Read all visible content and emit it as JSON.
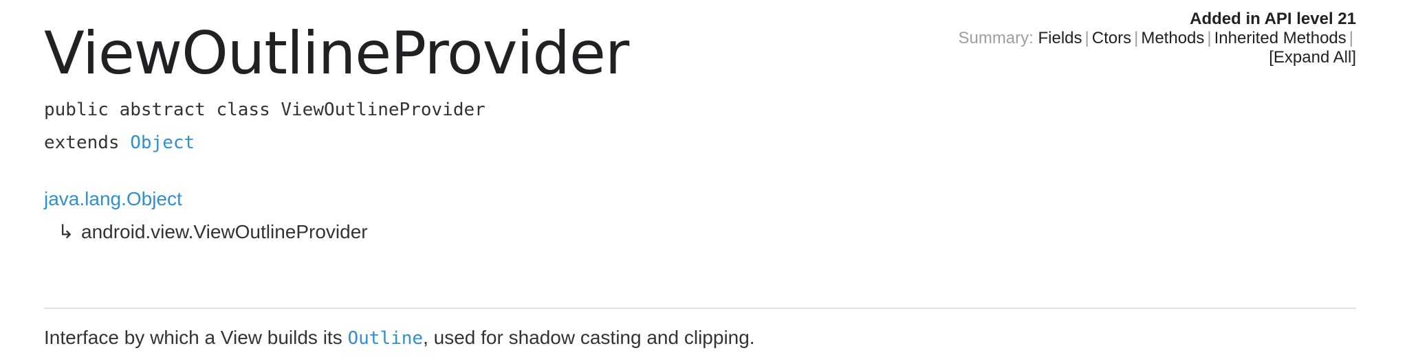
{
  "header": {
    "api_level": "Added in API level 21",
    "summary_label": "Summary:",
    "summary_links": [
      "Fields",
      "Ctors",
      "Methods",
      "Inherited Methods",
      "[Expand All]"
    ],
    "separator": "|"
  },
  "class": {
    "title": "ViewOutlineProvider",
    "declaration": "public abstract class ViewOutlineProvider",
    "extends_keyword": "extends",
    "extends_class": "Object"
  },
  "hierarchy": {
    "root": "java.lang.Object",
    "arrow": "↳",
    "child": "android.view.ViewOutlineProvider"
  },
  "description": {
    "prefix": "Interface by which a View builds its ",
    "code_link": "Outline",
    "suffix": ", used for shadow casting and clipping."
  },
  "colors": {
    "link": "#2f8fd3",
    "text": "#333333",
    "muted": "#9e9e9e",
    "divider": "#e0e0e0"
  }
}
